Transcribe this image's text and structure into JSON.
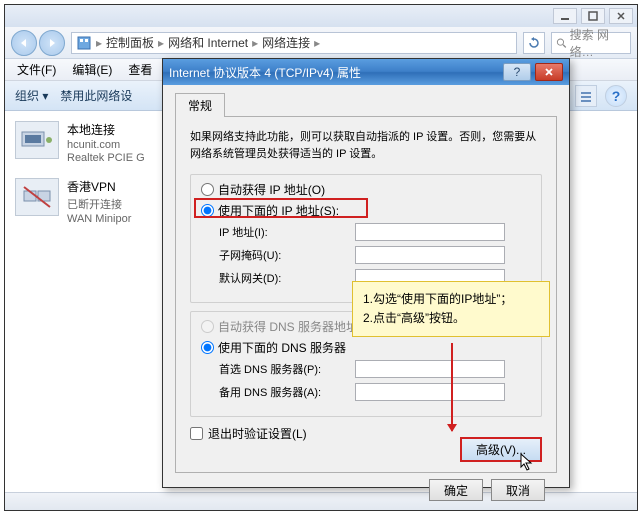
{
  "window": {
    "breadcrumb": [
      "控制面板",
      "网络和 Internet",
      "网络连接"
    ],
    "search_placeholder": "搜索 网络…"
  },
  "menubar": [
    "文件(F)",
    "编辑(E)",
    "查看"
  ],
  "toolbar": {
    "organize": "组织 ▾",
    "disable": "禁用此网络设"
  },
  "connections": [
    {
      "name": "本地连接",
      "sub1": "hcunit.com",
      "sub2": "Realtek PCIE G"
    },
    {
      "name": "香港VPN",
      "sub1": "已断开连接",
      "sub2": "WAN Minipor"
    }
  ],
  "dialog": {
    "title": "Internet 协议版本 4 (TCP/IPv4) 属性",
    "tab": "常规",
    "desc": "如果网络支持此功能，则可以获取自动指派的 IP 设置。否则，您需要从网络系统管理员处获得适当的 IP 设置。",
    "radio_auto_ip": "自动获得 IP 地址(O)",
    "radio_manual_ip": "使用下面的 IP 地址(S):",
    "lbl_ip": "IP 地址(I):",
    "lbl_mask": "子网掩码(U):",
    "lbl_gateway": "默认网关(D):",
    "radio_auto_dns": "自动获得 DNS 服务器地址",
    "radio_manual_dns": "使用下面的 DNS 服务器",
    "lbl_dns1": "首选 DNS 服务器(P):",
    "lbl_dns2": "备用 DNS 服务器(A):",
    "check_validate": "退出时验证设置(L)",
    "btn_advanced": "高级(V)...",
    "btn_ok": "确定",
    "btn_cancel": "取消"
  },
  "callout": {
    "line1": "1.勾选“使用下面的IP地址”；",
    "line2": "2.点击“高级”按钮。"
  }
}
